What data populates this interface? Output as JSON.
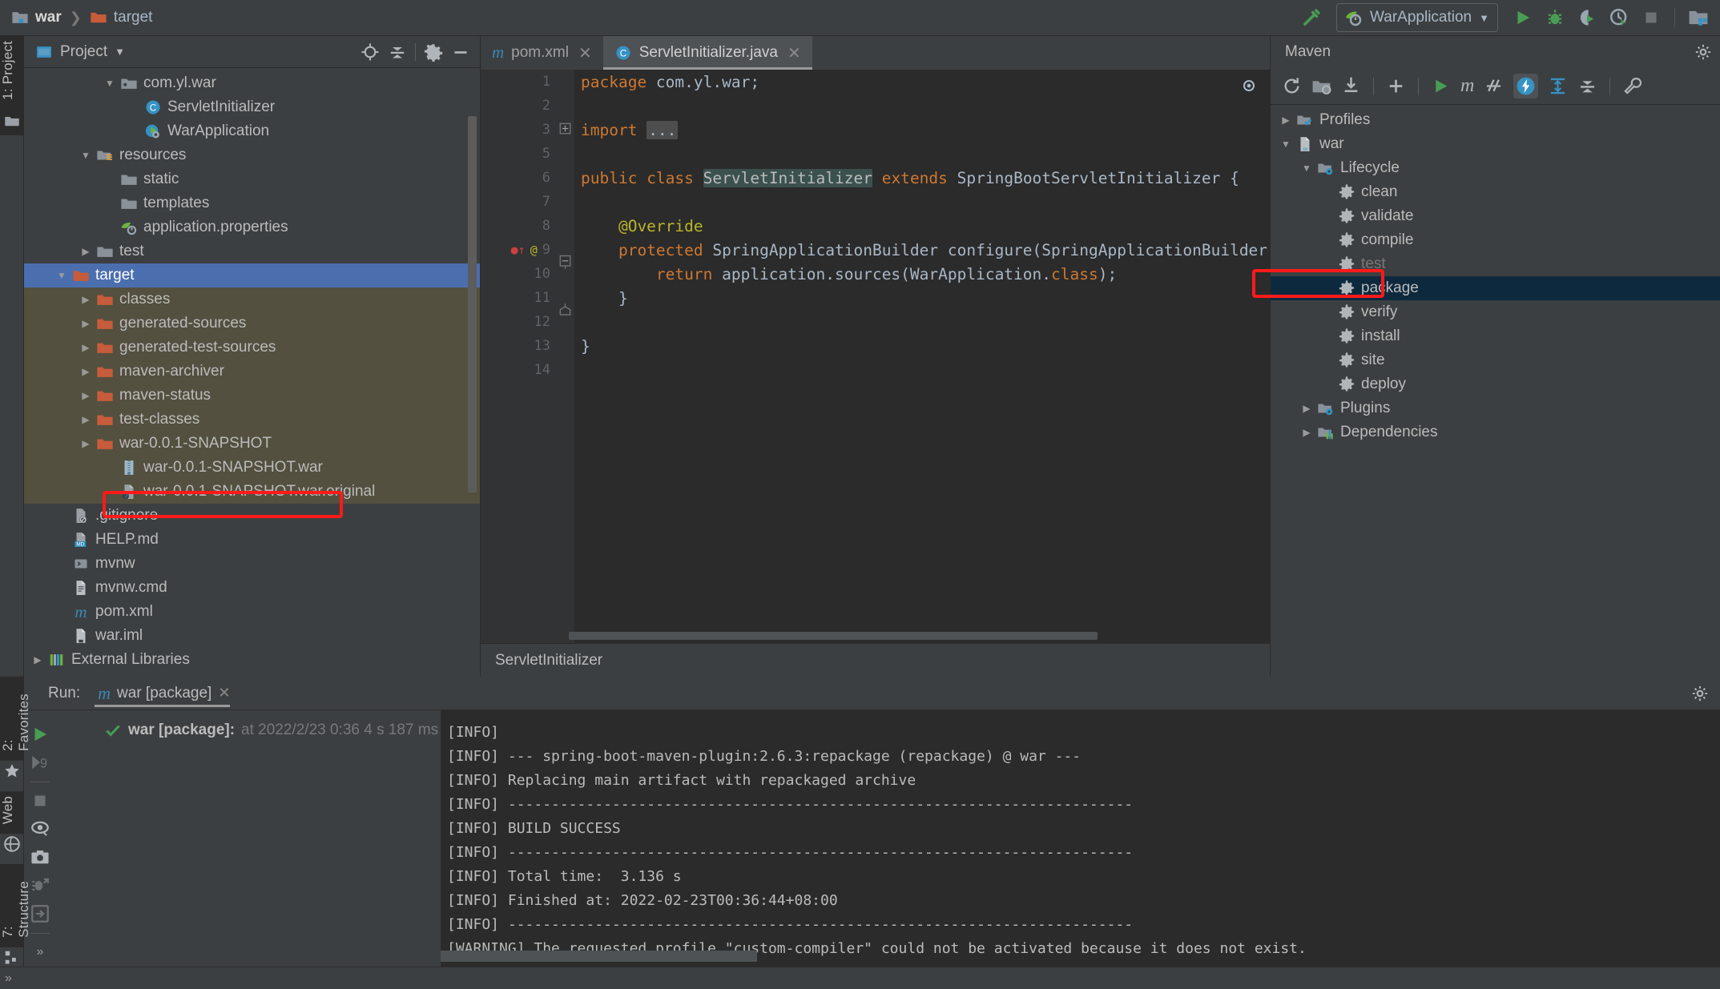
{
  "breadcrumb": {
    "project": "war",
    "folder": "target"
  },
  "toolbar": {
    "run_config": "WarApplication",
    "icons": [
      "hammer-build-icon",
      "run-icon",
      "debug-icon",
      "run-coverage-icon",
      "profile-icon",
      "stop-icon",
      "project-structure-icon"
    ]
  },
  "project_panel": {
    "title": "Project",
    "tools": [
      "locate-icon",
      "collapse-all-icon",
      "settings-gear-icon",
      "hide-icon"
    ],
    "vertical_tab": "1: Project",
    "tree": [
      {
        "label": "com.yl.war",
        "indent": 3,
        "arrow": "down",
        "icon": "package-folder-icon",
        "state": "normal"
      },
      {
        "label": "ServletInitializer",
        "indent": 4,
        "arrow": "none",
        "icon": "java-class-icon",
        "state": "normal"
      },
      {
        "label": "WarApplication",
        "indent": 4,
        "arrow": "none",
        "icon": "spring-class-icon",
        "state": "normal"
      },
      {
        "label": "resources",
        "indent": 2,
        "arrow": "down",
        "icon": "resources-folder-icon",
        "state": "normal"
      },
      {
        "label": "static",
        "indent": 3,
        "arrow": "none",
        "icon": "folder-icon",
        "state": "normal"
      },
      {
        "label": "templates",
        "indent": 3,
        "arrow": "none",
        "icon": "folder-icon",
        "state": "normal"
      },
      {
        "label": "application.properties",
        "indent": 3,
        "arrow": "none",
        "icon": "spring-properties-icon",
        "state": "normal"
      },
      {
        "label": "test",
        "indent": 2,
        "arrow": "right",
        "icon": "folder-icon",
        "state": "normal"
      },
      {
        "label": "target",
        "indent": 1,
        "arrow": "down",
        "icon": "excluded-folder-icon",
        "state": "selected"
      },
      {
        "label": "classes",
        "indent": 2,
        "arrow": "right",
        "icon": "excluded-folder-icon",
        "state": "target-child"
      },
      {
        "label": "generated-sources",
        "indent": 2,
        "arrow": "right",
        "icon": "excluded-folder-icon",
        "state": "target-child"
      },
      {
        "label": "generated-test-sources",
        "indent": 2,
        "arrow": "right",
        "icon": "excluded-folder-icon",
        "state": "target-child"
      },
      {
        "label": "maven-archiver",
        "indent": 2,
        "arrow": "right",
        "icon": "excluded-folder-icon",
        "state": "target-child"
      },
      {
        "label": "maven-status",
        "indent": 2,
        "arrow": "right",
        "icon": "excluded-folder-icon",
        "state": "target-child"
      },
      {
        "label": "test-classes",
        "indent": 2,
        "arrow": "right",
        "icon": "excluded-folder-icon",
        "state": "target-child"
      },
      {
        "label": "war-0.0.1-SNAPSHOT",
        "indent": 2,
        "arrow": "right",
        "icon": "excluded-folder-icon",
        "state": "target-child"
      },
      {
        "label": "war-0.0.1-SNAPSHOT.war",
        "indent": 3,
        "arrow": "none",
        "icon": "archive-file-icon",
        "state": "target-child"
      },
      {
        "label": "war-0.0.1-SNAPSHOT.war.original",
        "indent": 3,
        "arrow": "none",
        "icon": "unknown-file-icon",
        "state": "target-child"
      },
      {
        "label": ".gitignore",
        "indent": 1,
        "arrow": "none",
        "icon": "gitignore-file-icon",
        "state": "normal"
      },
      {
        "label": "HELP.md",
        "indent": 1,
        "arrow": "none",
        "icon": "markdown-file-icon",
        "state": "normal"
      },
      {
        "label": "mvnw",
        "indent": 1,
        "arrow": "none",
        "icon": "shell-script-icon",
        "state": "normal"
      },
      {
        "label": "mvnw.cmd",
        "indent": 1,
        "arrow": "none",
        "icon": "cmd-script-icon",
        "state": "normal"
      },
      {
        "label": "pom.xml",
        "indent": 1,
        "arrow": "none",
        "icon": "maven-pom-icon",
        "state": "normal"
      },
      {
        "label": "war.iml",
        "indent": 1,
        "arrow": "none",
        "icon": "iml-module-icon",
        "state": "normal"
      },
      {
        "label": "External Libraries",
        "indent": 0,
        "arrow": "right",
        "icon": "libraries-icon",
        "state": "normal"
      }
    ]
  },
  "editor": {
    "tabs": [
      {
        "label": "pom.xml",
        "icon": "maven-pom-icon",
        "active": false
      },
      {
        "label": "ServletInitializer.java",
        "icon": "java-class-icon",
        "active": true
      }
    ],
    "gutter_numbers": [
      "1",
      "2",
      "3",
      "5",
      "6",
      "7",
      "8",
      "9",
      "10",
      "11",
      "12",
      "13",
      "14"
    ],
    "lines": [
      {
        "n": "1",
        "tokens": [
          {
            "t": "package ",
            "c": "kw"
          },
          {
            "t": "com.yl.war;",
            "c": "plain"
          }
        ]
      },
      {
        "n": "2",
        "tokens": []
      },
      {
        "n": "3",
        "tokens": [
          {
            "t": "import ",
            "c": "kw"
          },
          {
            "t": "...",
            "c": "fold"
          }
        ]
      },
      {
        "n": "5",
        "tokens": []
      },
      {
        "n": "6",
        "tokens": [
          {
            "t": "public ",
            "c": "kw"
          },
          {
            "t": "class ",
            "c": "kw"
          },
          {
            "t": "ServletInitializer",
            "c": "hl"
          },
          {
            "t": " ",
            "c": "plain"
          },
          {
            "t": "extends ",
            "c": "kw"
          },
          {
            "t": "SpringBootServletInitializer {",
            "c": "plain"
          }
        ]
      },
      {
        "n": "7",
        "tokens": []
      },
      {
        "n": "8",
        "tokens": [
          {
            "t": "    @Override",
            "c": "ann"
          }
        ]
      },
      {
        "n": "9",
        "tokens": [
          {
            "t": "    ",
            "c": "plain"
          },
          {
            "t": "protected ",
            "c": "kw"
          },
          {
            "t": "SpringApplicationBuilder configure(SpringApplicationBuilder applica",
            "c": "plain"
          }
        ]
      },
      {
        "n": "10",
        "tokens": [
          {
            "t": "        ",
            "c": "plain"
          },
          {
            "t": "return ",
            "c": "kw"
          },
          {
            "t": "application.sources(WarApplication.",
            "c": "plain"
          },
          {
            "t": "class",
            "c": "kw"
          },
          {
            "t": ");",
            "c": "plain"
          }
        ]
      },
      {
        "n": "11",
        "tokens": [
          {
            "t": "    }",
            "c": "plain"
          }
        ]
      },
      {
        "n": "12",
        "tokens": []
      },
      {
        "n": "13",
        "tokens": [
          {
            "t": "}",
            "c": "plain"
          }
        ]
      },
      {
        "n": "14",
        "tokens": []
      }
    ],
    "breadcrumb": "ServletInitializer"
  },
  "maven": {
    "title": "Maven",
    "tools": [
      "reload-icon",
      "add-maven-project-icon",
      "download-sources-icon",
      "add-icon",
      "run-icon",
      "execute-maven-goal-icon",
      "toggle-skip-tests-icon",
      "toggle-offline-mode-icon",
      "expand-all-icon",
      "collapse-all-icon",
      "settings-wrench-icon"
    ],
    "tree": [
      {
        "label": "Profiles",
        "indent": 0,
        "arrow": "right",
        "icon": "profiles-icon",
        "state": "normal"
      },
      {
        "label": "war",
        "indent": 0,
        "arrow": "down",
        "icon": "maven-module-icon",
        "state": "normal"
      },
      {
        "label": "Lifecycle",
        "indent": 1,
        "arrow": "down",
        "icon": "lifecycle-folder-icon",
        "state": "normal"
      },
      {
        "label": "clean",
        "indent": 2,
        "arrow": "none",
        "icon": "maven-goal-icon",
        "state": "normal"
      },
      {
        "label": "validate",
        "indent": 2,
        "arrow": "none",
        "icon": "maven-goal-icon",
        "state": "normal"
      },
      {
        "label": "compile",
        "indent": 2,
        "arrow": "none",
        "icon": "maven-goal-icon",
        "state": "normal"
      },
      {
        "label": "test",
        "indent": 2,
        "arrow": "none",
        "icon": "maven-goal-icon",
        "state": "dim"
      },
      {
        "label": "package",
        "indent": 2,
        "arrow": "none",
        "icon": "maven-goal-icon",
        "state": "selected"
      },
      {
        "label": "verify",
        "indent": 2,
        "arrow": "none",
        "icon": "maven-goal-icon",
        "state": "normal"
      },
      {
        "label": "install",
        "indent": 2,
        "arrow": "none",
        "icon": "maven-goal-icon",
        "state": "normal"
      },
      {
        "label": "site",
        "indent": 2,
        "arrow": "none",
        "icon": "maven-goal-icon",
        "state": "normal"
      },
      {
        "label": "deploy",
        "indent": 2,
        "arrow": "none",
        "icon": "maven-goal-icon",
        "state": "normal"
      },
      {
        "label": "Plugins",
        "indent": 1,
        "arrow": "right",
        "icon": "plugins-folder-icon",
        "state": "normal"
      },
      {
        "label": "Dependencies",
        "indent": 1,
        "arrow": "right",
        "icon": "dependencies-icon",
        "state": "normal"
      }
    ]
  },
  "run_panel": {
    "label": "Run:",
    "tab": "war [package]",
    "tree_entry": {
      "title": "war [package]:",
      "meta": "at 2022/2/23 0:36 4 s 187 ms"
    },
    "side_icons": [
      "rerun-icon",
      "rerun-failed-tests-icon",
      "stop-icon",
      "toggle-soft-wrap-icon",
      "screenshot-icon",
      "thread-dump-icon",
      "export-icon"
    ],
    "console": [
      "[INFO]",
      "[INFO] --- spring-boot-maven-plugin:2.6.3:repackage (repackage) @ war ---",
      "[INFO] Replacing main artifact with repackaged archive",
      "[INFO] ------------------------------------------------------------------------",
      "[INFO] BUILD SUCCESS",
      "[INFO] ------------------------------------------------------------------------",
      "[INFO] Total time:  3.136 s",
      "[INFO] Finished at: 2022-02-23T00:36:44+08:00",
      "[INFO] ------------------------------------------------------------------------",
      "[WARNING] The requested profile \"custom-compiler\" could not be activated because it does not exist."
    ]
  },
  "left_strip": {
    "tabs": [
      "2: Favorites",
      "Web",
      "7: Structure"
    ],
    "status_chevron": "»"
  },
  "colors": {
    "selection_blue": "#4b6eaf",
    "maven_selection": "#0d293e",
    "target_child_bg": "#53503f",
    "annotation_red": "#ff1a1a",
    "accent_green": "#499c54"
  }
}
